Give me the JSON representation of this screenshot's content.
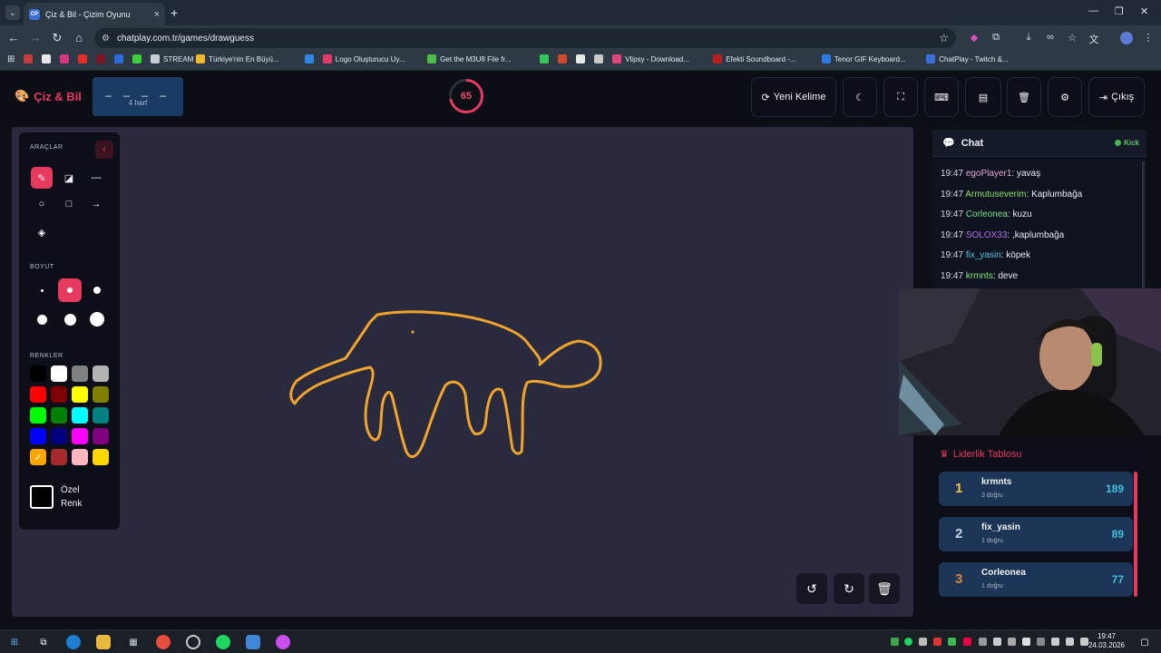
{
  "browser": {
    "tab_title": "Çiz & Bil - Çizim Oyunu",
    "tab_favicon": "CP",
    "url": "chatplay.com.tr/games/drawguess",
    "bookmarks": [
      {
        "label": "",
        "color": "#c53d3d"
      },
      {
        "label": "",
        "color": "#e8e8e8"
      },
      {
        "label": "",
        "color": "#d6377f"
      },
      {
        "label": "",
        "color": "#e52d27"
      },
      {
        "label": "",
        "color": "#7a1525"
      },
      {
        "label": "",
        "color": "#2d6ddb"
      },
      {
        "label": "",
        "color": "#3ad13c"
      },
      {
        "label": "STREAM",
        "color": "#c7ccd2"
      },
      {
        "label": "Türkiye'nin En Büyü...",
        "color": "#f1b82c"
      },
      {
        "label": "",
        "color": "#2f86e6"
      },
      {
        "label": "Logo Oluşturucu Uy...",
        "color": "#e0396a"
      },
      {
        "label": "Get the M3U8 File fr...",
        "color": "#4fbf49"
      },
      {
        "label": "",
        "color": "#34c759"
      },
      {
        "label": "",
        "color": "#d04a2a"
      },
      {
        "label": "",
        "color": "#e8e8e8"
      },
      {
        "label": "",
        "color": "#c8c8c8"
      },
      {
        "label": "Vlipsy - Download...",
        "color": "#e04475"
      },
      {
        "label": "Efekti Soundboard -...",
        "color": "#b81f1f"
      },
      {
        "label": "Tenor GIF Keyboard...",
        "color": "#2b7be0"
      },
      {
        "label": "ChatPlay - Twitch &...",
        "color": "#3a70d8"
      }
    ]
  },
  "header": {
    "logo": "Çiz & Bil",
    "word_blanks": "_ _ _ _",
    "word_hint": "4 harf",
    "timer": "65",
    "timer_fraction": 0.72,
    "new_word": "Yeni Kelime",
    "exit": "Çıkış"
  },
  "tools": {
    "tools_label": "ARAÇLAR",
    "size_label": "BOYUT",
    "colors_label": "RENKLER",
    "custom_line1": "Özel",
    "custom_line2": "Renk",
    "colors": [
      "#000000",
      "#ffffff",
      "#808080",
      "#b4b4b4",
      "#ff0000",
      "#800000",
      "#ffff00",
      "#808000",
      "#00ff00",
      "#008000",
      "#00ffff",
      "#008080",
      "#0000ff",
      "#000080",
      "#ff00ff",
      "#800080",
      "#ffa500",
      "#a52a2a",
      "#ffb6c1",
      "#ffd700"
    ],
    "selected_color": "#ffa500"
  },
  "chat": {
    "title": "Chat",
    "platform": "Kick",
    "messages": [
      {
        "time": "19:47",
        "user": "egoPlayer1",
        "color": "#e7a6d9",
        "text": ": yavaş"
      },
      {
        "time": "19:47",
        "user": "Armutuseverim",
        "color": "#8de06b",
        "text": ": Kaplumbağa"
      },
      {
        "time": "19:47",
        "user": "Corleonea",
        "color": "#79e08b",
        "text": ": kuzu"
      },
      {
        "time": "19:47",
        "user": "SOLOX33",
        "color": "#b66de8",
        "text": ": ,kaplumbağa"
      },
      {
        "time": "19:47",
        "user": "fix_yasin",
        "color": "#4fc7e3",
        "text": ": köpek"
      },
      {
        "time": "19:47",
        "user": "krmnts",
        "color": "#7ee87b",
        "text": ": deve"
      }
    ]
  },
  "leaderboard": {
    "title": "Liderlik Tablosu",
    "rows": [
      {
        "rank": "1",
        "name": "krmnts",
        "sub": "3 doğru",
        "score": "189",
        "rank_color": "#f5c542"
      },
      {
        "rank": "2",
        "name": "fix_yasin",
        "sub": "1 doğru",
        "score": "89",
        "rank_color": "#c9d2de"
      },
      {
        "rank": "3",
        "name": "Corleonea",
        "sub": "1 doğru",
        "score": "77",
        "rank_color": "#d9883a"
      }
    ]
  },
  "taskbar": {
    "time": "19:47",
    "date": "24.03.2026"
  }
}
